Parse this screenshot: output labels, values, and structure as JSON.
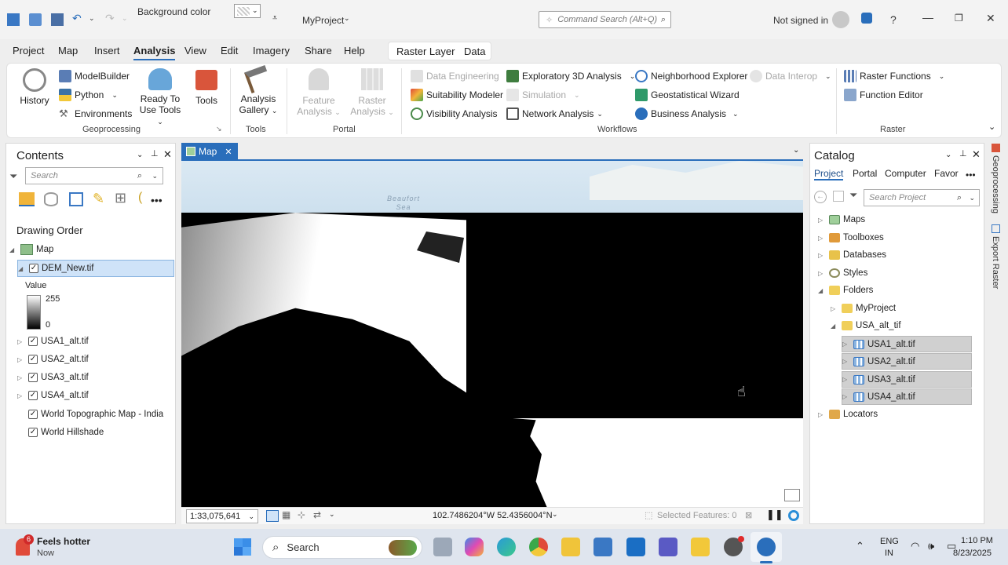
{
  "titlebar": {
    "background_color_label": "Background color",
    "project_name": "MyProject",
    "command_search_placeholder": "Command Search (Alt+Q)",
    "signed_in_status": "Not signed in",
    "help_label": "?"
  },
  "ribbon_tabs": [
    "Project",
    "Map",
    "Insert",
    "Analysis",
    "View",
    "Edit",
    "Imagery",
    "Share",
    "Help"
  ],
  "active_tab": "Analysis",
  "context_tabs": [
    "Raster Layer",
    "Data"
  ],
  "ribbon": {
    "history": "History",
    "modelbuilder": "ModelBuilder",
    "python": "Python",
    "environments": "Environments",
    "ready_to_use_1": "Ready To",
    "ready_to_use_2": "Use Tools",
    "tools": "Tools",
    "geoprocessing_label": "Geoprocessing",
    "analysis_gallery_1": "Analysis",
    "analysis_gallery_2": "Gallery",
    "tools_group_label": "Tools",
    "feature_analysis_1": "Feature",
    "feature_analysis_2": "Analysis",
    "raster_analysis_1": "Raster",
    "raster_analysis_2": "Analysis",
    "portal_label": "Portal",
    "data_engineering": "Data Engineering",
    "suitability_modeler": "Suitability Modeler",
    "visibility_analysis": "Visibility Analysis",
    "exploratory_3d": "Exploratory 3D Analysis",
    "simulation": "Simulation",
    "network_analysis": "Network Analysis",
    "neighborhood_explorer": "Neighborhood Explorer",
    "geostatistical_wizard": "Geostatistical Wizard",
    "business_analysis": "Business Analysis",
    "data_interop": "Data Interop",
    "workflows_label": "Workflows",
    "raster_functions": "Raster Functions",
    "function_editor": "Function Editor",
    "raster_label": "Raster"
  },
  "contents": {
    "title": "Contents",
    "search_placeholder": "Search",
    "drawing_order": "Drawing Order",
    "map_label": "Map",
    "selected_layer": "DEM_New.tif",
    "value_label": "Value",
    "legend_max": "255",
    "legend_min": "0",
    "layers": [
      "USA1_alt.tif",
      "USA2_alt.tif",
      "USA3_alt.tif",
      "USA4_alt.tif",
      "World Topographic Map - India",
      "World Hillshade"
    ]
  },
  "map": {
    "tab_label": "Map",
    "place_label_1": "Beaufort",
    "place_label_2": "Sea",
    "scale": "1:33,075,641",
    "coordinates": "102.7486204°W 52.4356004°N",
    "selected_features": "Selected Features: 0"
  },
  "catalog": {
    "title": "Catalog",
    "tabs": [
      "Project",
      "Portal",
      "Computer",
      "Favor"
    ],
    "search_placeholder": "Search Project",
    "items": [
      "Maps",
      "Toolboxes",
      "Databases",
      "Styles",
      "Folders"
    ],
    "folder_myproject": "MyProject",
    "folder_usa": "USA_alt_tif",
    "rasters": [
      "USA1_alt.tif",
      "USA2_alt.tif",
      "USA3_alt.tif",
      "USA4_alt.tif"
    ],
    "locators": "Locators"
  },
  "side_tabs": [
    "Geoprocessing",
    "Export Raster"
  ],
  "taskbar": {
    "weather_badge": "6",
    "weather_title": "Feels hotter",
    "weather_sub": "Now",
    "search_label": "Search",
    "lang_1": "ENG",
    "lang_2": "IN",
    "time": "1:10 PM",
    "date": "8/23/2025"
  }
}
